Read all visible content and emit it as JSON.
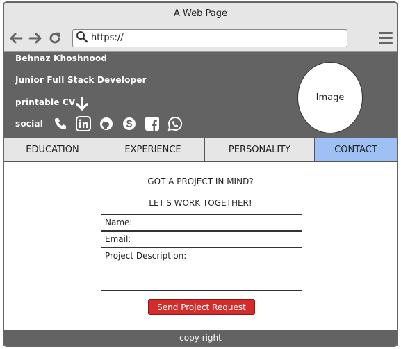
{
  "window": {
    "title": "A Web Page"
  },
  "browser": {
    "url": "https://"
  },
  "header": {
    "name": "Behnaz Khoshnood",
    "role": "Junior Full Stack Developer",
    "cv_label": "printable CV",
    "social_label": "social",
    "social_icons": [
      "phone-icon",
      "linkedin-icon",
      "github-icon",
      "skype-icon",
      "facebook-icon",
      "whatsapp-icon"
    ],
    "avatar_label": "Image"
  },
  "tabs": [
    {
      "label": "EDUCATION",
      "active": false
    },
    {
      "label": "EXPERIENCE",
      "active": false
    },
    {
      "label": "PERSONALITY",
      "active": false
    },
    {
      "label": "CONTACT",
      "active": true
    }
  ],
  "contact": {
    "headline_1": "GOT A PROJECT IN MIND?",
    "headline_2": "LET'S WORK TOGETHER!",
    "name_label": "Name:",
    "email_label": "Email:",
    "description_label": "Project Description:",
    "submit_label": "Send Project Request"
  },
  "footer": {
    "text": "copy right"
  },
  "colors": {
    "header_bg": "#636363",
    "active_tab": "#9ec0f5",
    "submit_bg": "#d42b2b"
  }
}
